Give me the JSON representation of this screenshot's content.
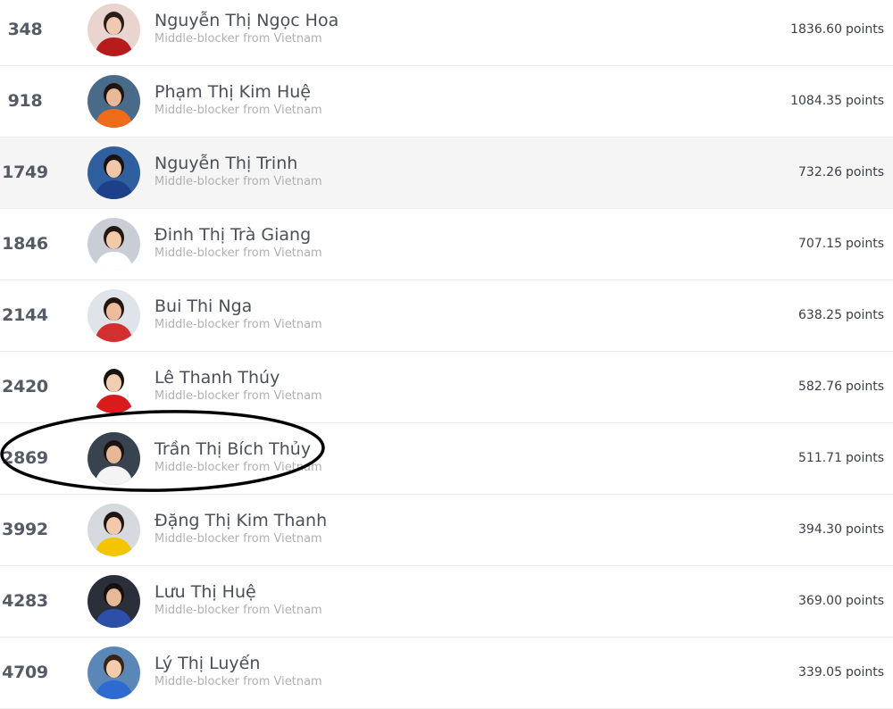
{
  "points_unit": "points",
  "players": [
    {
      "rank": "348",
      "name": "Nguyễn Thị Ngọc Hoa",
      "subtitle": "Middle-blocker from Vietnam",
      "points": "1836.60",
      "avatar_bg": "#e9d4cf",
      "avatar_fg": "#b71c1c",
      "avatar_skin": "#f1c8b0",
      "avatar_hair": "#2b1c16"
    },
    {
      "rank": "918",
      "name": "Phạm Thị Kim Huệ",
      "subtitle": "Middle-blocker from Vietnam",
      "points": "1084.35",
      "avatar_bg": "#4a6a8a",
      "avatar_fg": "#ef6c1a",
      "avatar_skin": "#e9b896",
      "avatar_hair": "#1f1510"
    },
    {
      "rank": "1749",
      "name": "Nguyễn Thị Trinh",
      "subtitle": "Middle-blocker from Vietnam",
      "points": "732.26",
      "avatar_bg": "#2f5f9e",
      "avatar_fg": "#1e3f8a",
      "avatar_skin": "#f0c7a8",
      "avatar_hair": "#1a120e"
    },
    {
      "rank": "1846",
      "name": "Đinh Thị Trà Giang",
      "subtitle": "Middle-blocker from Vietnam",
      "points": "707.15",
      "avatar_bg": "#c9ced6",
      "avatar_fg": "#ffffff",
      "avatar_skin": "#f2caa9",
      "avatar_hair": "#241812"
    },
    {
      "rank": "2144",
      "name": "Bui Thi Nga",
      "subtitle": "Middle-blocker from Vietnam",
      "points": "638.25",
      "avatar_bg": "#dfe4ea",
      "avatar_fg": "#d32f2f",
      "avatar_skin": "#ecbc9c",
      "avatar_hair": "#22160f"
    },
    {
      "rank": "2420",
      "name": "Lê Thanh Thúy",
      "subtitle": "Middle-blocker from Vietnam",
      "points": "582.76",
      "avatar_bg": "#ffffff",
      "avatar_fg": "#d81b1b",
      "avatar_skin": "#f3cdb1",
      "avatar_hair": "#1b120d"
    },
    {
      "rank": "2869",
      "name": "Trần Thị Bích Thủy",
      "subtitle": "Middle-blocker from Vietnam",
      "points": "511.71",
      "avatar_bg": "#39434f",
      "avatar_fg": "#f4f4f4",
      "avatar_skin": "#e7b897",
      "avatar_hair": "#1c130e"
    },
    {
      "rank": "3992",
      "name": "Đặng Thị Kim Thanh",
      "subtitle": "Middle-blocker from Vietnam",
      "points": "394.30",
      "avatar_bg": "#d6d9dd",
      "avatar_fg": "#f2c500",
      "avatar_skin": "#f1c9ad",
      "avatar_hair": "#20150f"
    },
    {
      "rank": "4283",
      "name": "Lưu Thị Huệ",
      "subtitle": "Middle-blocker from Vietnam",
      "points": "369.00",
      "avatar_bg": "#2b2f3a",
      "avatar_fg": "#2d4fa8",
      "avatar_skin": "#e8b996",
      "avatar_hair": "#17100c"
    },
    {
      "rank": "4709",
      "name": "Lý Thị Luyến",
      "subtitle": "Middle-blocker from Vietnam",
      "points": "339.05",
      "avatar_bg": "#5b87b8",
      "avatar_fg": "#2e6bd0",
      "avatar_skin": "#f3cbae",
      "avatar_hair": "#3a2415"
    }
  ],
  "highlighted_rank": "1749",
  "circled_rank": "2869"
}
